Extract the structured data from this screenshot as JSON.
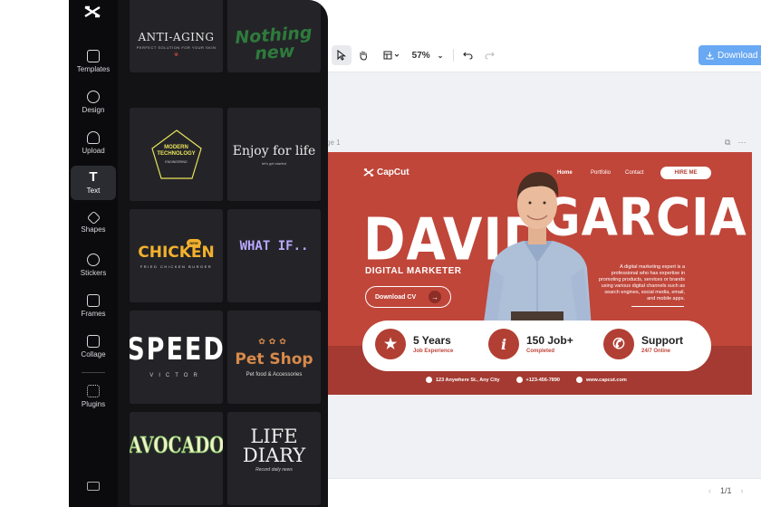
{
  "app": {
    "logo_glyph": "⌘"
  },
  "rail": {
    "items": [
      {
        "label": "Templates",
        "icon": "templates-icon"
      },
      {
        "label": "Design",
        "icon": "design-icon"
      },
      {
        "label": "Upload",
        "icon": "upload-cloud-icon"
      },
      {
        "label": "Text",
        "icon": "text-icon",
        "active": true,
        "glyph": "T"
      },
      {
        "label": "Shapes",
        "icon": "shapes-icon"
      },
      {
        "label": "Stickers",
        "icon": "stickers-icon"
      },
      {
        "label": "Frames",
        "icon": "frames-icon"
      },
      {
        "label": "Collage",
        "icon": "collage-icon"
      },
      {
        "label": "Plugins",
        "icon": "plugins-icon"
      }
    ]
  },
  "text_styles": [
    {
      "title": "ANTI-AGING",
      "subtitle": "PERFECT SOLUTION FOR YOUR SKIN"
    },
    {
      "title_line1": "Nothing",
      "title_line2": "new"
    },
    {
      "title_line1": "MODERN",
      "title_line2": "TECHNOLOGY",
      "subtitle": "ENGINEERING"
    },
    {
      "title": "Enjoy for life",
      "subtitle": "let's get started"
    },
    {
      "title": "CHICKEN",
      "badge": "NEW",
      "subtitle": "FRIED CHICKEN BURGER"
    },
    {
      "title": "WHAT IF.."
    },
    {
      "title": "SPEED",
      "subtitle": "VICTOR"
    },
    {
      "title": "Pet Shop",
      "subtitle": "Pet food & Accessories"
    },
    {
      "title": "AVOCADO"
    },
    {
      "title_line1": "LIFE",
      "title_line2": "DIARY",
      "subtitle": "Record daily news"
    }
  ],
  "toolbar": {
    "zoom": "57%",
    "download_label": "Download a"
  },
  "page": {
    "label": "ge 1",
    "pager": "1/1"
  },
  "design": {
    "brand": "CapCut",
    "nav": {
      "home": "Home",
      "portfolio": "Portfolio",
      "contact": "Contact",
      "hire": "HIRE ME"
    },
    "first_name": "DAVID",
    "last_name": "GARCIA",
    "role": "DIGITAL MARKETER",
    "download_cv": "Download CV",
    "description": "A digital marketing expert is a professional who has expertise in promoting products, services or brands using various digital channels such as search engines, social media, email, and mobile apps.",
    "stats": [
      {
        "title": "5 Years",
        "sub": "Job Experience",
        "icon": "star-icon"
      },
      {
        "title": "150 Job+",
        "sub": "Completed",
        "icon": "info-icon"
      },
      {
        "title": "Support",
        "sub": "24/7 Online",
        "icon": "phone-icon"
      }
    ],
    "contacts": {
      "address": "123 Anywhere St., Any City",
      "phone": "+123-456-7890",
      "web": "www.capcut.com"
    },
    "accent": "#c0463a",
    "accent_dark": "#a43a31"
  }
}
